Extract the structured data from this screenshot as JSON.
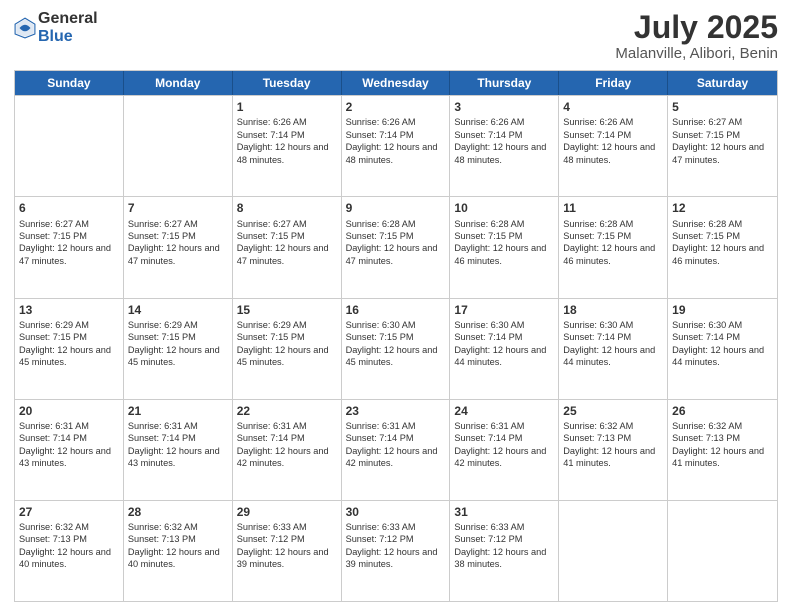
{
  "header": {
    "logo_general": "General",
    "logo_blue": "Blue",
    "title": "July 2025",
    "subtitle": "Malanville, Alibori, Benin"
  },
  "days_of_week": [
    "Sunday",
    "Monday",
    "Tuesday",
    "Wednesday",
    "Thursday",
    "Friday",
    "Saturday"
  ],
  "weeks": [
    [
      {
        "day": "",
        "sunrise": "",
        "sunset": "",
        "daylight": ""
      },
      {
        "day": "",
        "sunrise": "",
        "sunset": "",
        "daylight": ""
      },
      {
        "day": "1",
        "sunrise": "Sunrise: 6:26 AM",
        "sunset": "Sunset: 7:14 PM",
        "daylight": "Daylight: 12 hours and 48 minutes."
      },
      {
        "day": "2",
        "sunrise": "Sunrise: 6:26 AM",
        "sunset": "Sunset: 7:14 PM",
        "daylight": "Daylight: 12 hours and 48 minutes."
      },
      {
        "day": "3",
        "sunrise": "Sunrise: 6:26 AM",
        "sunset": "Sunset: 7:14 PM",
        "daylight": "Daylight: 12 hours and 48 minutes."
      },
      {
        "day": "4",
        "sunrise": "Sunrise: 6:26 AM",
        "sunset": "Sunset: 7:14 PM",
        "daylight": "Daylight: 12 hours and 48 minutes."
      },
      {
        "day": "5",
        "sunrise": "Sunrise: 6:27 AM",
        "sunset": "Sunset: 7:15 PM",
        "daylight": "Daylight: 12 hours and 47 minutes."
      }
    ],
    [
      {
        "day": "6",
        "sunrise": "Sunrise: 6:27 AM",
        "sunset": "Sunset: 7:15 PM",
        "daylight": "Daylight: 12 hours and 47 minutes."
      },
      {
        "day": "7",
        "sunrise": "Sunrise: 6:27 AM",
        "sunset": "Sunset: 7:15 PM",
        "daylight": "Daylight: 12 hours and 47 minutes."
      },
      {
        "day": "8",
        "sunrise": "Sunrise: 6:27 AM",
        "sunset": "Sunset: 7:15 PM",
        "daylight": "Daylight: 12 hours and 47 minutes."
      },
      {
        "day": "9",
        "sunrise": "Sunrise: 6:28 AM",
        "sunset": "Sunset: 7:15 PM",
        "daylight": "Daylight: 12 hours and 47 minutes."
      },
      {
        "day": "10",
        "sunrise": "Sunrise: 6:28 AM",
        "sunset": "Sunset: 7:15 PM",
        "daylight": "Daylight: 12 hours and 46 minutes."
      },
      {
        "day": "11",
        "sunrise": "Sunrise: 6:28 AM",
        "sunset": "Sunset: 7:15 PM",
        "daylight": "Daylight: 12 hours and 46 minutes."
      },
      {
        "day": "12",
        "sunrise": "Sunrise: 6:28 AM",
        "sunset": "Sunset: 7:15 PM",
        "daylight": "Daylight: 12 hours and 46 minutes."
      }
    ],
    [
      {
        "day": "13",
        "sunrise": "Sunrise: 6:29 AM",
        "sunset": "Sunset: 7:15 PM",
        "daylight": "Daylight: 12 hours and 45 minutes."
      },
      {
        "day": "14",
        "sunrise": "Sunrise: 6:29 AM",
        "sunset": "Sunset: 7:15 PM",
        "daylight": "Daylight: 12 hours and 45 minutes."
      },
      {
        "day": "15",
        "sunrise": "Sunrise: 6:29 AM",
        "sunset": "Sunset: 7:15 PM",
        "daylight": "Daylight: 12 hours and 45 minutes."
      },
      {
        "day": "16",
        "sunrise": "Sunrise: 6:30 AM",
        "sunset": "Sunset: 7:15 PM",
        "daylight": "Daylight: 12 hours and 45 minutes."
      },
      {
        "day": "17",
        "sunrise": "Sunrise: 6:30 AM",
        "sunset": "Sunset: 7:14 PM",
        "daylight": "Daylight: 12 hours and 44 minutes."
      },
      {
        "day": "18",
        "sunrise": "Sunrise: 6:30 AM",
        "sunset": "Sunset: 7:14 PM",
        "daylight": "Daylight: 12 hours and 44 minutes."
      },
      {
        "day": "19",
        "sunrise": "Sunrise: 6:30 AM",
        "sunset": "Sunset: 7:14 PM",
        "daylight": "Daylight: 12 hours and 44 minutes."
      }
    ],
    [
      {
        "day": "20",
        "sunrise": "Sunrise: 6:31 AM",
        "sunset": "Sunset: 7:14 PM",
        "daylight": "Daylight: 12 hours and 43 minutes."
      },
      {
        "day": "21",
        "sunrise": "Sunrise: 6:31 AM",
        "sunset": "Sunset: 7:14 PM",
        "daylight": "Daylight: 12 hours and 43 minutes."
      },
      {
        "day": "22",
        "sunrise": "Sunrise: 6:31 AM",
        "sunset": "Sunset: 7:14 PM",
        "daylight": "Daylight: 12 hours and 42 minutes."
      },
      {
        "day": "23",
        "sunrise": "Sunrise: 6:31 AM",
        "sunset": "Sunset: 7:14 PM",
        "daylight": "Daylight: 12 hours and 42 minutes."
      },
      {
        "day": "24",
        "sunrise": "Sunrise: 6:31 AM",
        "sunset": "Sunset: 7:14 PM",
        "daylight": "Daylight: 12 hours and 42 minutes."
      },
      {
        "day": "25",
        "sunrise": "Sunrise: 6:32 AM",
        "sunset": "Sunset: 7:13 PM",
        "daylight": "Daylight: 12 hours and 41 minutes."
      },
      {
        "day": "26",
        "sunrise": "Sunrise: 6:32 AM",
        "sunset": "Sunset: 7:13 PM",
        "daylight": "Daylight: 12 hours and 41 minutes."
      }
    ],
    [
      {
        "day": "27",
        "sunrise": "Sunrise: 6:32 AM",
        "sunset": "Sunset: 7:13 PM",
        "daylight": "Daylight: 12 hours and 40 minutes."
      },
      {
        "day": "28",
        "sunrise": "Sunrise: 6:32 AM",
        "sunset": "Sunset: 7:13 PM",
        "daylight": "Daylight: 12 hours and 40 minutes."
      },
      {
        "day": "29",
        "sunrise": "Sunrise: 6:33 AM",
        "sunset": "Sunset: 7:12 PM",
        "daylight": "Daylight: 12 hours and 39 minutes."
      },
      {
        "day": "30",
        "sunrise": "Sunrise: 6:33 AM",
        "sunset": "Sunset: 7:12 PM",
        "daylight": "Daylight: 12 hours and 39 minutes."
      },
      {
        "day": "31",
        "sunrise": "Sunrise: 6:33 AM",
        "sunset": "Sunset: 7:12 PM",
        "daylight": "Daylight: 12 hours and 38 minutes."
      },
      {
        "day": "",
        "sunrise": "",
        "sunset": "",
        "daylight": ""
      },
      {
        "day": "",
        "sunrise": "",
        "sunset": "",
        "daylight": ""
      }
    ]
  ]
}
